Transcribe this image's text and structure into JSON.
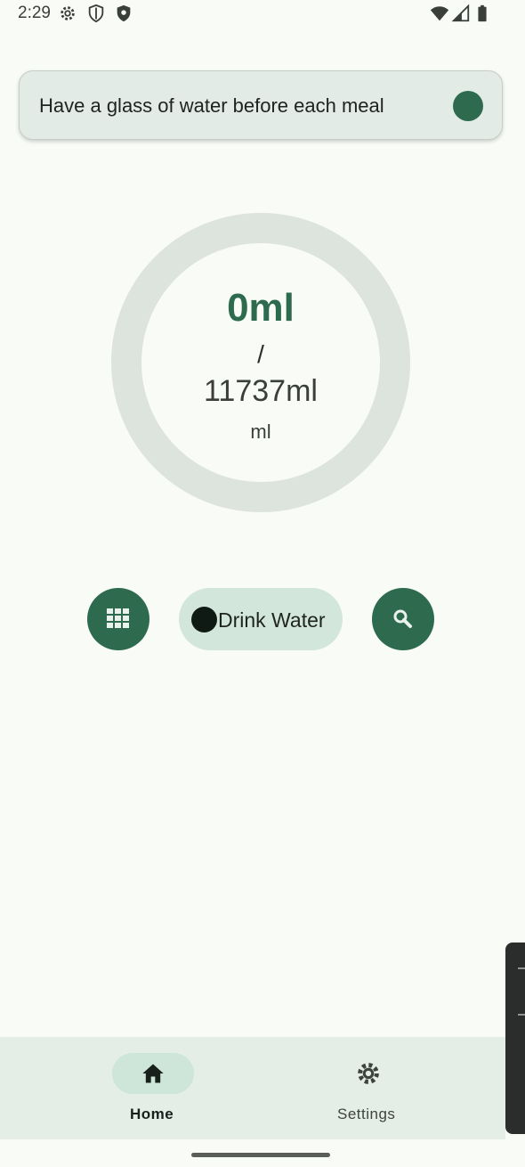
{
  "status_bar": {
    "time": "2:29",
    "icons": [
      "settings-icon",
      "shield-outline-icon",
      "shield-filled-icon",
      "wifi-icon",
      "signal-icon",
      "battery-icon"
    ]
  },
  "tip": {
    "text": "Have a glass of water before each meal",
    "indicator_color": "#2e6b4e"
  },
  "progress": {
    "current": "0ml",
    "separator": "/",
    "goal": "11737ml",
    "unit": "ml",
    "fraction": 0
  },
  "actions": {
    "left_icon": "grid-icon",
    "drink_label": "Drink Water",
    "right_icon": "search-icon"
  },
  "nav": {
    "items": [
      {
        "label": "Home",
        "icon": "home-icon",
        "selected": true
      },
      {
        "label": "Settings",
        "icon": "settings-icon",
        "selected": false
      }
    ]
  },
  "colors": {
    "primary": "#2e6b4e",
    "background": "#f8fbf6",
    "ring_track": "#dde3dd",
    "nav_background": "#e4eee7"
  }
}
